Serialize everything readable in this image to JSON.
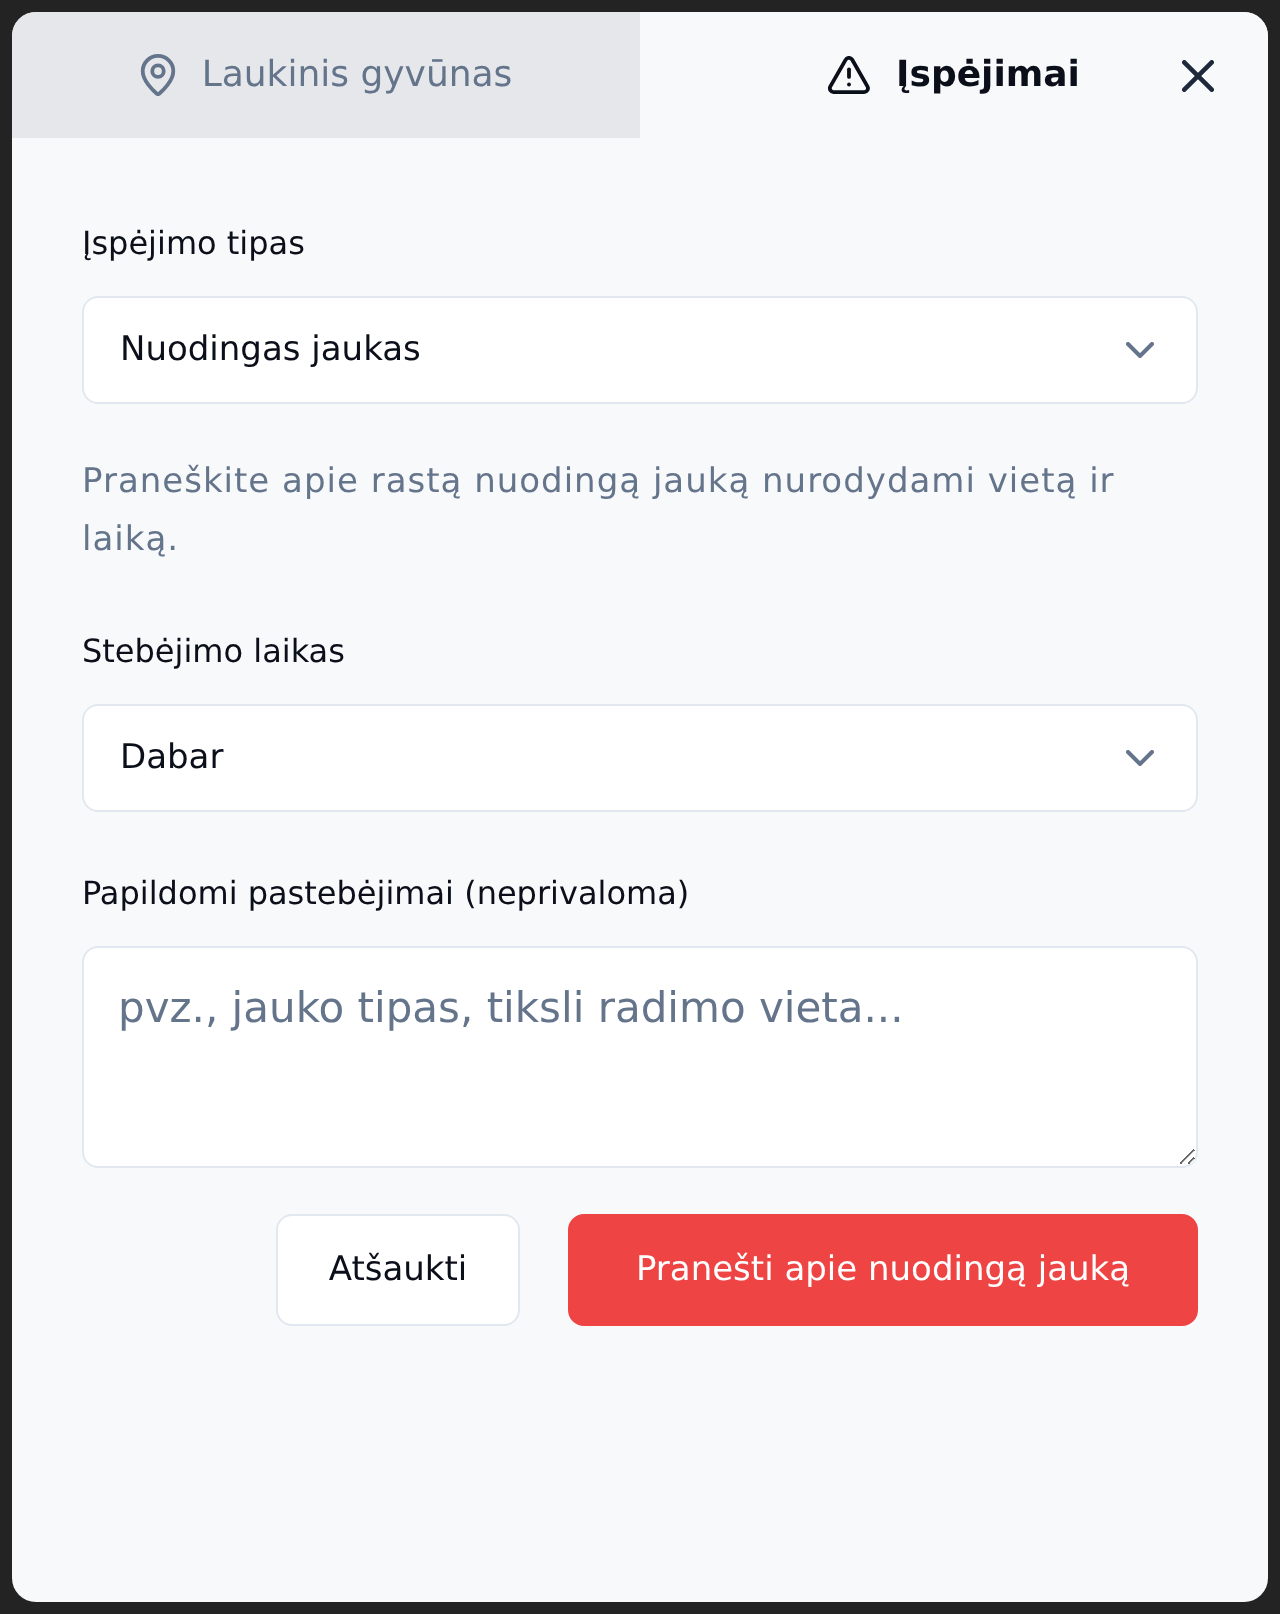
{
  "tabs": [
    {
      "label": "Laukinis gyvūnas",
      "kind": "location",
      "selected": false
    },
    {
      "label": "Įspėjimai",
      "kind": "warning",
      "selected": true
    }
  ],
  "fields": [
    {
      "kind": "select",
      "label": "Įspėjimo tipas",
      "value": "Nuodingas jaukas",
      "help": "Praneškite apie rastą nuodingą jauką nurodydami vietą ir laiką."
    },
    {
      "kind": "select",
      "label": "Stebėjimo laikas",
      "value": "Dabar"
    },
    {
      "kind": "textarea",
      "label": "Papildomi pastebėjimai (neprivaloma)",
      "placeholder": "pvz., jauko tipas, tiksli radimo vieta..."
    }
  ],
  "buttons": [
    {
      "label": "Atšaukti",
      "kind": "secondary"
    },
    {
      "label": "Pranešti apie nuodingą jauką",
      "kind": "danger"
    }
  ]
}
